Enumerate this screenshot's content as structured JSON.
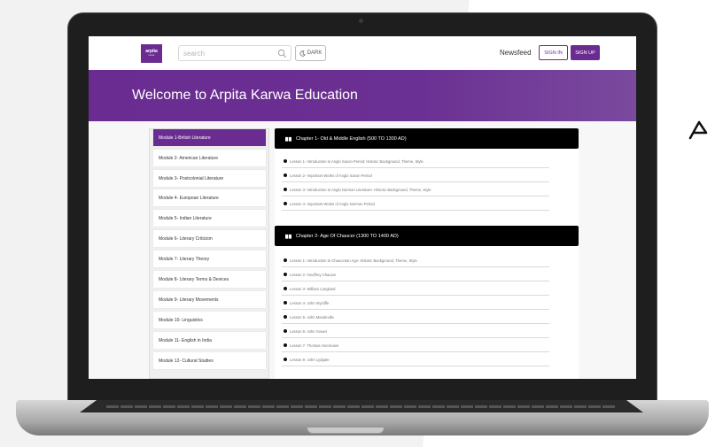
{
  "header": {
    "logo_text": "arpita",
    "logo_sub": "karwa",
    "search_placeholder": "search",
    "dark_label": "DARK",
    "newsfeed": "Newsfeed",
    "signin": "SIGN IN",
    "signup": "SIGN UP"
  },
  "hero": {
    "title": "Welcome to Arpita Karwa Education"
  },
  "sidebar": {
    "modules": [
      "Module 1-British Literature",
      "Module 2- American Literature",
      "Module 3- Postcolonial Literature",
      "Module 4- European Literature",
      "Module 5- Indian Literature",
      "Module 6- Literary Criticism",
      "Module 7- Literary Theory",
      "Module 8- Literary Terms & Devices",
      "Module 9- Literary Movements",
      "Module 10- Linguistics",
      "Module 11- English in India",
      "Module 12- Cultural Studies"
    ]
  },
  "chapters": [
    {
      "title": "Chapter 1- Old & Middle English (500 TO 1300 AD)",
      "lessons": [
        "Lesson 1- Introduction to Anglo Saxon Period: Historic Background, Theme, Style",
        "Lesson 2- Important Works of Anglo Saxon Period",
        "Lesson 3- Introduction to Anglo Norman Literature- Historic Background, Theme, Style",
        "Lesson 4- Important Works of Anglo Norman Period"
      ]
    },
    {
      "title": "Chapter 2- Age Of Chaucer (1300 TO 1400 AD)",
      "lessons": [
        "Lesson 1- Introduction to Chaucerian Age: Historic Background, Theme, Style",
        "Lesson 2- Geoffrey Chaucer",
        "Lesson 3- William Langland",
        "Lesson 4- John Wycliffe",
        "Lesson 5- John Mandeville",
        "Lesson 6- John Gower",
        "Lesson 7- Thomas Hoccleave",
        "Lesson 8- John Lydgate"
      ]
    }
  ],
  "colors": {
    "brand": "#6a2c91",
    "chapter_bar": "#000000"
  }
}
